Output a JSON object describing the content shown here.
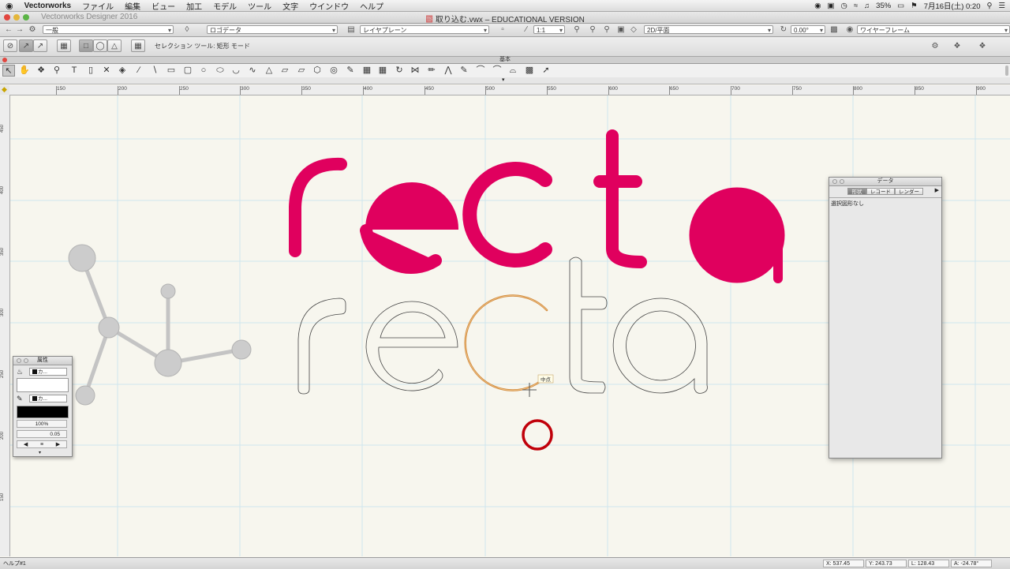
{
  "menubar": {
    "apple": "",
    "app": "Vectorworks",
    "items": [
      "ファイル",
      "編集",
      "ビュー",
      "加工",
      "モデル",
      "ツール",
      "文字",
      "ウインドウ",
      "ヘルプ"
    ],
    "battery": "35%",
    "clock": "7月16日(土) 0:20"
  },
  "window": {
    "app_title": "Vectorworks Designer 2016",
    "doc_title": "取り込む.vwx – EDUCATIONAL VERSION"
  },
  "viewbar": {
    "class_menu": "一般",
    "layer_menu": "ロゴデータ",
    "plane_menu": "レイヤプレーン",
    "scale": "1:1",
    "view_menu": "2D/平面",
    "angle": "0.00°",
    "render_menu": "ワイヤーフレーム"
  },
  "modebar": {
    "label": "セレクション ツール: 矩形 モード"
  },
  "palette": {
    "title": "基本"
  },
  "ruler": {
    "h_ticks": [
      "150",
      "200",
      "250",
      "300",
      "350",
      "400",
      "450",
      "500",
      "550",
      "600",
      "650",
      "700",
      "750",
      "800",
      "850",
      "900"
    ],
    "v_ticks": [
      "450",
      "400",
      "350",
      "300",
      "250",
      "200",
      "150"
    ]
  },
  "canvas": {
    "logo_text": "recta",
    "accent": "#e0005e",
    "snap_tooltip": "中点",
    "circle_color": "#c0000a",
    "molecule_color": "#cccccc"
  },
  "attr_palette": {
    "title": "属性",
    "fill_menu": "カ...",
    "pen_menu": "カ...",
    "opacity": "100%",
    "line_weight": "0.05"
  },
  "data_palette": {
    "title": "データ",
    "tabs": [
      "形状",
      "レコード",
      "レンダー"
    ],
    "message": "選択図形なし"
  },
  "statusbar": {
    "help": "ヘルプ#1",
    "x": "X: 537.45",
    "y": "Y: 243.73",
    "l": "L: 128.43",
    "a": "A: -24.78°"
  }
}
